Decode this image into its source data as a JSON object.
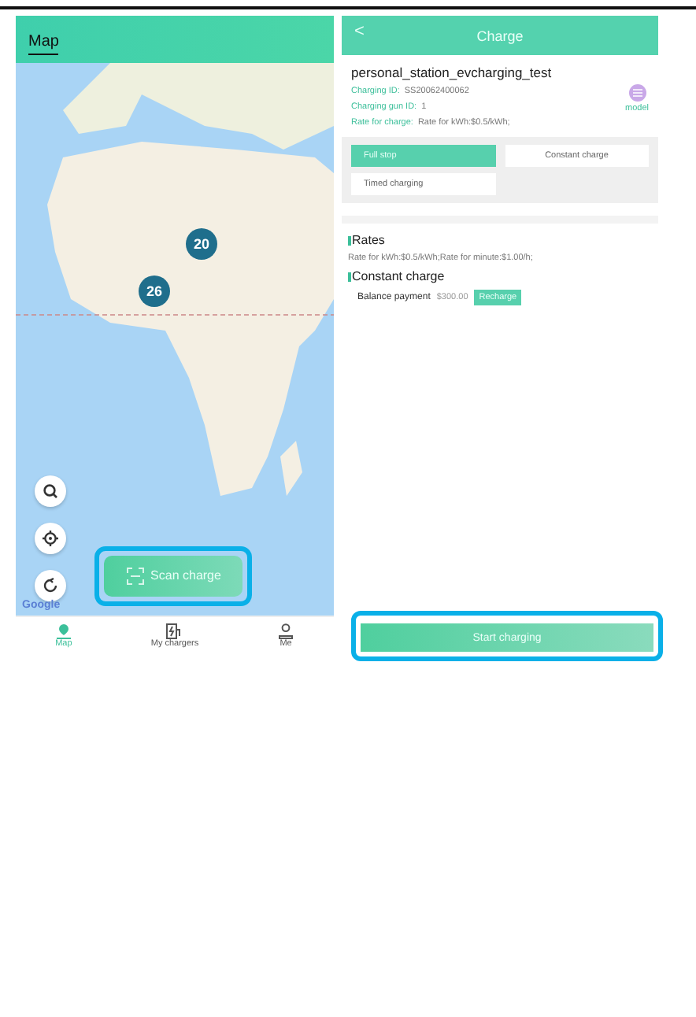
{
  "map_screen": {
    "title": "Map",
    "clusters": [
      {
        "count": "20"
      },
      {
        "count": "26"
      }
    ],
    "map_attribution": "Google",
    "scan_button": {
      "label": "Scan charge",
      "highlighted": true
    },
    "nav": [
      {
        "label": "Map",
        "selected": true
      },
      {
        "label": "My chargers",
        "selected": false
      },
      {
        "label": "Me",
        "selected": false
      }
    ]
  },
  "charge_screen": {
    "back": "<",
    "title": "Charge",
    "station": "personal_station_evcharging_test",
    "details": [
      {
        "label": "Charging ID:",
        "value": "SS20062400062"
      },
      {
        "label": "Charging gun ID:",
        "value": "1"
      },
      {
        "label": "Rate for charge:",
        "value": "Rate for kWh:$0.5/kWh;"
      }
    ],
    "model_label": "model",
    "modes": [
      {
        "label": "Full stop",
        "selected": true
      },
      {
        "label": "Constant charge",
        "selected": false
      },
      {
        "label": "Timed charging",
        "selected": false
      }
    ],
    "rates": {
      "heading": "Rates",
      "text": "Rate for kWh:$0.5/kWh;Rate for minute:$1.00/h;"
    },
    "constant": {
      "heading": "Constant charge",
      "label": "Balance payment",
      "amount": "$300.00",
      "button": "Recharge"
    },
    "start_button": {
      "label": "Start charging",
      "highlighted": true
    }
  }
}
